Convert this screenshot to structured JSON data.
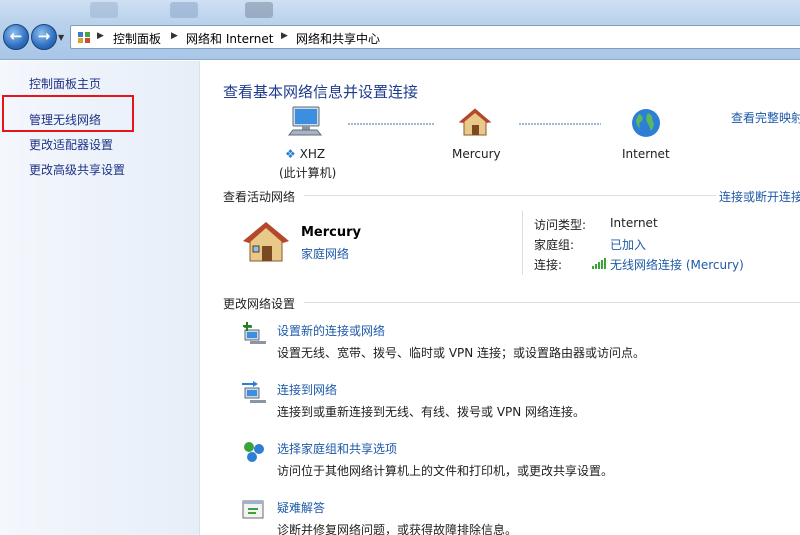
{
  "breadcrumb": [
    "控制面板",
    "网络和 Internet",
    "网络和共享中心"
  ],
  "sidebar": {
    "items": [
      {
        "label": "控制面板主页"
      },
      {
        "label": "管理无线网络"
      },
      {
        "label": "更改适配器设置"
      },
      {
        "label": "更改高级共享设置"
      }
    ]
  },
  "main": {
    "title": "查看基本网络信息并设置连接",
    "full_map_link": "查看完整映射",
    "map": {
      "computer_name": "XHZ",
      "computer_sub": "(此计算机)",
      "network_name": "Mercury",
      "internet_label": "Internet"
    },
    "active_section": {
      "title": "查看活动网络",
      "connect_link": "连接或断开连接",
      "network_name": "Mercury",
      "network_type": "家庭网络",
      "access_type_key": "访问类型:",
      "access_type_val": "Internet",
      "homegroup_key": "家庭组:",
      "homegroup_val": "已加入",
      "connection_key": "连接:",
      "connection_val": "无线网络连接 (Mercury)"
    },
    "change_section": {
      "title": "更改网络设置",
      "tasks": [
        {
          "link": "设置新的连接或网络",
          "desc": "设置无线、宽带、拨号、临时或 VPN 连接；或设置路由器或访问点。",
          "icon": "new-connection-icon"
        },
        {
          "link": "连接到网络",
          "desc": "连接到或重新连接到无线、有线、拨号或 VPN 网络连接。",
          "icon": "connect-network-icon"
        },
        {
          "link": "选择家庭组和共享选项",
          "desc": "访问位于其他网络计算机上的文件和打印机，或更改共享设置。",
          "icon": "homegroup-icon"
        },
        {
          "link": "疑难解答",
          "desc": "诊断并修复网络问题，或获得故障排除信息。",
          "icon": "troubleshoot-icon"
        }
      ]
    }
  },
  "colors": {
    "link": "#1e5aa8",
    "title": "#1e3c8c",
    "highlight_box": "#e8141b"
  }
}
